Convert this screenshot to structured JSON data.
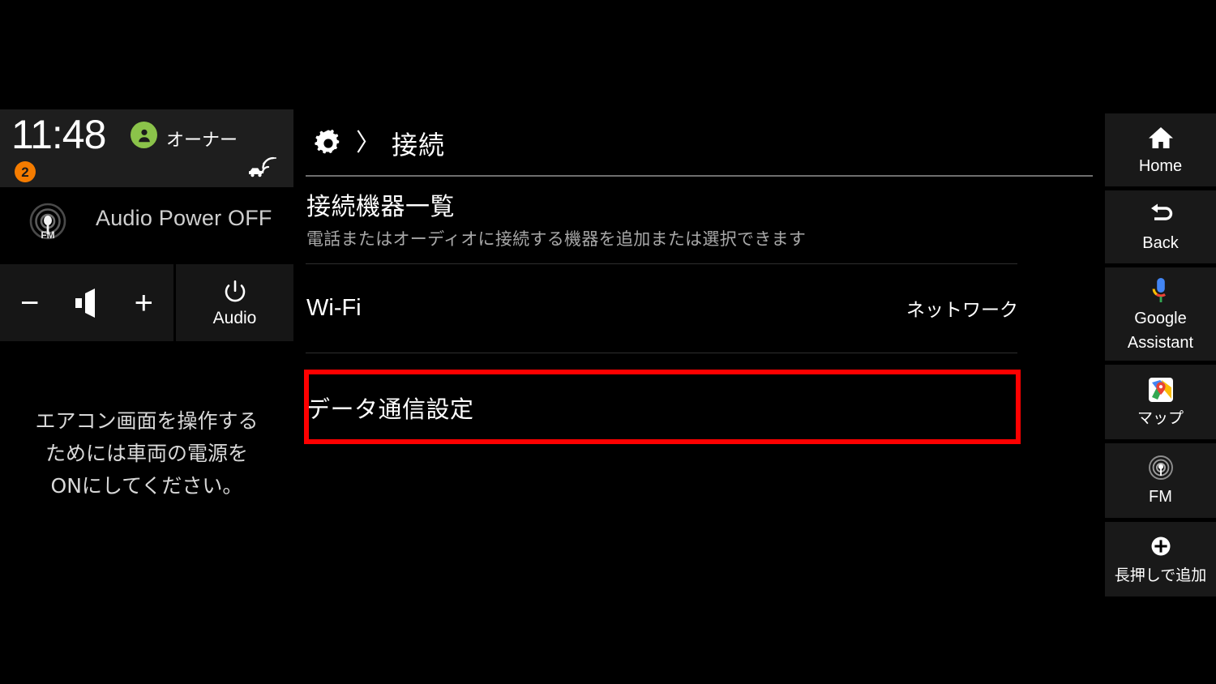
{
  "theme": {
    "background": "#000000",
    "panel": "#191919",
    "status_bar": "#1e1e1e",
    "accent_green": "#8bc34a",
    "accent_orange": "#f57c00",
    "highlight_red": "#fe0000",
    "text_primary": "#ffffff",
    "text_secondary": "#a8a8a8"
  },
  "left_panel": {
    "status_bar": {
      "clock": "11:48",
      "avatar_icon": "person-avatar-icon",
      "profile_name": "オーナー",
      "notification_count": "2",
      "connectivity_icon": "connected-car-icon"
    },
    "audio_status": {
      "source_icon": "fm-radio-icon",
      "source_icon_label": "FM",
      "text": "Audio Power OFF"
    },
    "volume": {
      "minus_label": "−",
      "speaker_icon": "speaker-icon",
      "plus_label": "+"
    },
    "audio_button": {
      "icon": "power-icon",
      "label": "Audio"
    },
    "ac_message": [
      "エアコン画面を操作する",
      "ためには車両の電源を",
      "ONにしてください。"
    ]
  },
  "main": {
    "breadcrumb": {
      "icon": "settings-gear-icon",
      "separator": "〉",
      "current": "接続"
    },
    "section": {
      "title": "接続機器一覧",
      "subtitle": "電話またはオーディオに接続する機器を追加または選択できます"
    },
    "rows": [
      {
        "label": "Wi-Fi",
        "value": "ネットワーク",
        "highlighted": false
      },
      {
        "label": "データ通信設定",
        "value": "",
        "highlighted": true
      }
    ]
  },
  "sidebar": {
    "items": [
      {
        "icon": "home-icon",
        "label": "Home"
      },
      {
        "icon": "back-arrow-icon",
        "label": "Back"
      },
      {
        "icon": "google-assistant-mic-icon",
        "label": "Google\nAssistant",
        "label_line1": "Google",
        "label_line2": "Assistant"
      },
      {
        "icon": "google-maps-icon",
        "label": "マップ"
      },
      {
        "icon": "fm-radio-icon",
        "label": "FM"
      },
      {
        "icon": "plus-circle-icon",
        "label": "長押しで追加"
      }
    ]
  }
}
